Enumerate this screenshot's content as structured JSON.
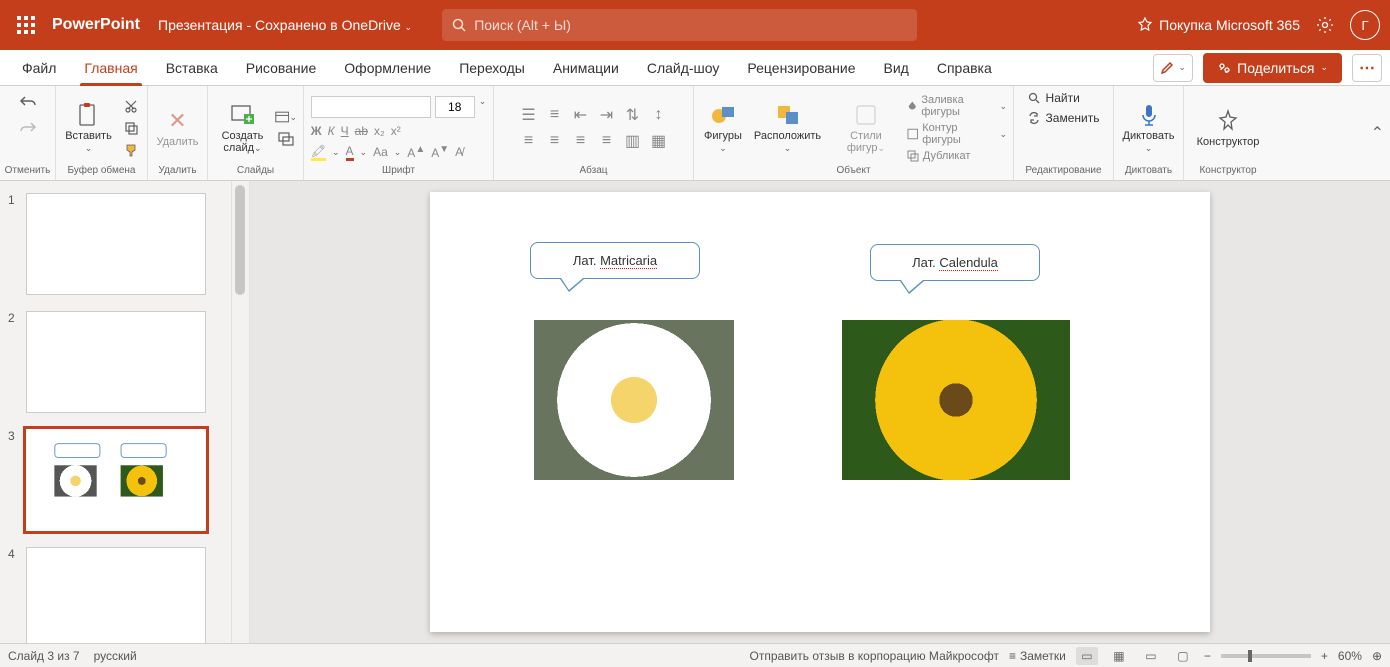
{
  "title": {
    "app_name": "PowerPoint",
    "doc_name": "Презентация",
    "save_state": "Сохранено в OneDrive",
    "search_placeholder": "Поиск (Alt + Ы)",
    "buy_label": "Покупка Microsoft 365",
    "avatar_initial": "Г"
  },
  "tabs": {
    "file": "Файл",
    "home": "Главная",
    "insert": "Вставка",
    "draw": "Рисование",
    "design": "Оформление",
    "transitions": "Переходы",
    "animations": "Анимации",
    "slideshow": "Слайд-шоу",
    "review": "Рецензирование",
    "view": "Вид",
    "help": "Справка",
    "share": "Поделиться"
  },
  "ribbon": {
    "undo": "Отменить",
    "clipboard": {
      "paste": "Вставить",
      "label": "Буфер обмена"
    },
    "delete": {
      "btn": "Удалить",
      "label": "Удалить"
    },
    "slides": {
      "new_slide": "Создать слайд",
      "label": "Слайды"
    },
    "font": {
      "label": "Шрифт",
      "size": "18"
    },
    "paragraph": {
      "label": "Абзац"
    },
    "shapes": {
      "shapes": "Фигуры",
      "arrange": "Расположить",
      "styles": "Стили фигур",
      "fill": "Заливка фигуры",
      "outline": "Контур фигуры",
      "duplicate": "Дубликат",
      "label": "Объект"
    },
    "editing": {
      "find": "Найти",
      "replace": "Заменить",
      "label": "Редактирование"
    },
    "dictate": {
      "btn": "Диктовать",
      "label": "Диктовать"
    },
    "designer": {
      "btn": "Конструктор",
      "label": "Конструктор"
    }
  },
  "slide": {
    "callout1_prefix": "Лат. ",
    "callout1_word": "Matricaria",
    "callout2_prefix": "Лат. ",
    "callout2_word": "Calendula"
  },
  "thumbs": {
    "n1": "1",
    "n2": "2",
    "n3": "3",
    "n4": "4"
  },
  "status": {
    "slide_info": "Слайд 3 из 7",
    "language": "русский",
    "feedback": "Отправить отзыв в корпорацию Майкрософт",
    "notes": "Заметки",
    "zoom": "60%"
  }
}
